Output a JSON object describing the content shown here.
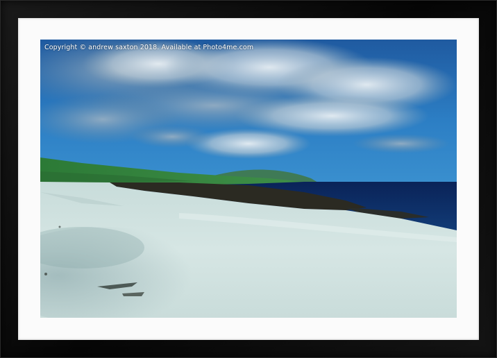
{
  "photo": {
    "watermark": "Copyright  © andrew saxton  2018. Available at Photo4me.com"
  },
  "colors": {
    "frame": "#0b0b0b",
    "mount": "#fbfbfb",
    "sky_top": "#1f5fa8",
    "sky_bottom": "#2f86c9",
    "sea": "#0c2c63",
    "grass": "#2f7a3a",
    "sand": "#cfe0df"
  }
}
